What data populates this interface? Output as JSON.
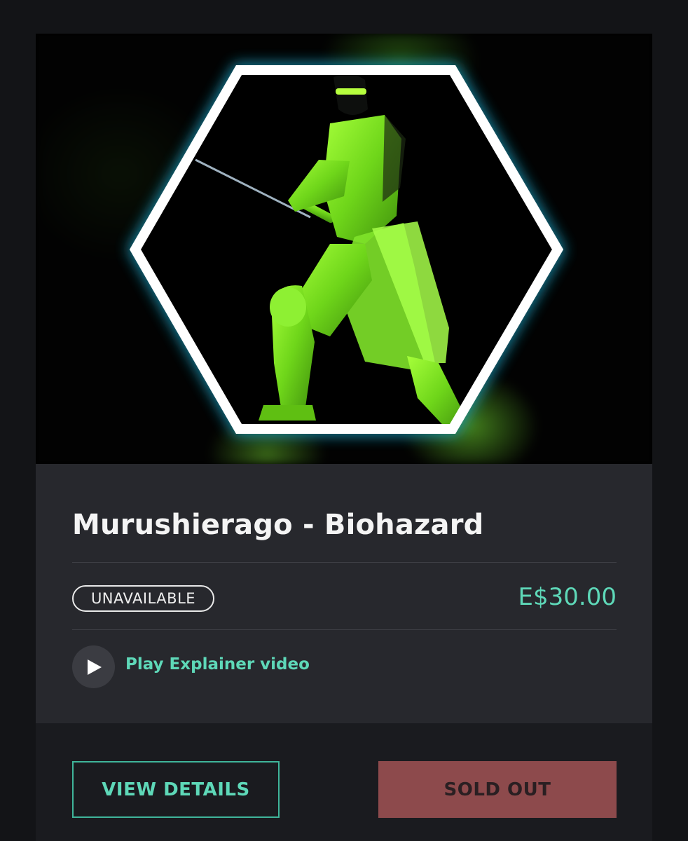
{
  "item": {
    "title": "Murushierago - Biohazard",
    "status": "UNAVAILABLE",
    "price": "E$30.00",
    "video_label": "Play Explainer video",
    "image_icon": "ninja-character-image"
  },
  "actions": {
    "details_label": "VIEW DETAILS",
    "sold_label": "SOLD OUT"
  },
  "colors": {
    "accent": "#5ed8b8",
    "sold_out": "#8d4a4c",
    "panel": "#27282d",
    "background": "#131417",
    "hex_border": "#ffffff",
    "hex_glow": "#1aa6c8",
    "character": "#7ee21f"
  }
}
